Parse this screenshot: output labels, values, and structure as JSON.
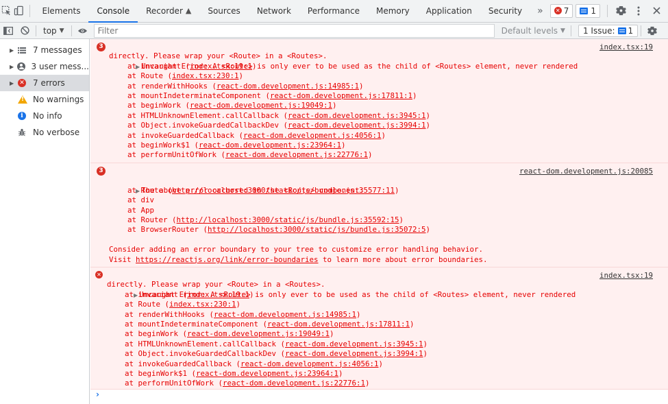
{
  "tabs": [
    {
      "label": "Elements"
    },
    {
      "label": "Console"
    },
    {
      "label": "Recorder"
    },
    {
      "label": "Sources"
    },
    {
      "label": "Network"
    },
    {
      "label": "Performance"
    },
    {
      "label": "Memory"
    },
    {
      "label": "Application"
    },
    {
      "label": "Security"
    }
  ],
  "topbar": {
    "more_label": "»",
    "error_count": "7",
    "issue_count": "1"
  },
  "toolbar": {
    "context": "top",
    "filter_placeholder": "Filter",
    "levels_label": "Default levels",
    "issues_label": "1 Issue:",
    "issues_count": "1"
  },
  "sidebar": {
    "items": [
      {
        "label": "7 messages"
      },
      {
        "label": "3 user mess..."
      },
      {
        "label": "7 errors"
      },
      {
        "label": "No warnings"
      },
      {
        "label": "No info"
      },
      {
        "label": "No verbose"
      }
    ]
  },
  "messages": [
    {
      "count": "3",
      "head": "Uncaught Error: A <Route> is only ever to be used as the child of <Routes> element, never rendered",
      "cont": "directly. Please wrap your <Route> in a <Routes>.",
      "source": "index.tsx:19",
      "frames": [
        {
          "fn": "at invariant (",
          "loc": "index.tsx:19:1",
          "end": ")"
        },
        {
          "fn": "at Route (",
          "loc": "index.tsx:230:1",
          "end": ")"
        },
        {
          "fn": "at renderWithHooks (",
          "loc": "react-dom.development.js:14985:1",
          "end": ")"
        },
        {
          "fn": "at mountIndeterminateComponent (",
          "loc": "react-dom.development.js:17811:1",
          "end": ")"
        },
        {
          "fn": "at beginWork (",
          "loc": "react-dom.development.js:19049:1",
          "end": ")"
        },
        {
          "fn": "at HTMLUnknownElement.callCallback (",
          "loc": "react-dom.development.js:3945:1",
          "end": ")"
        },
        {
          "fn": "at Object.invokeGuardedCallbackDev (",
          "loc": "react-dom.development.js:3994:1",
          "end": ")"
        },
        {
          "fn": "at invokeGuardedCallback (",
          "loc": "react-dom.development.js:4056:1",
          "end": ")"
        },
        {
          "fn": "at beginWork$1 (",
          "loc": "react-dom.development.js:23964:1",
          "end": ")"
        },
        {
          "fn": "at performUnitOfWork (",
          "loc": "react-dom.development.js:22776:1",
          "end": ")"
        }
      ]
    },
    {
      "count": "3",
      "head": "The above error occurred in the <Route> component:",
      "source": "react-dom.development.js:20085",
      "frames": [
        {
          "fn": "at Route (",
          "loc": "http://localhost:3000/static/js/bundle.js:35577:11",
          "end": ")"
        },
        {
          "fn": "at div",
          "loc": "",
          "end": ""
        },
        {
          "fn": "at App",
          "loc": "",
          "end": ""
        },
        {
          "fn": "at Router (",
          "loc": "http://localhost:3000/static/js/bundle.js:35592:15",
          "end": ")"
        },
        {
          "fn": "at BrowserRouter (",
          "loc": "http://localhost:3000/static/js/bundle.js:35072:5",
          "end": ")"
        }
      ],
      "footer1": "Consider adding an error boundary to your tree to customize error handling behavior.",
      "footer2_pre": "Visit ",
      "footer2_link": "https://reactjs.org/link/error-boundaries",
      "footer2_post": " to learn more about error boundaries."
    },
    {
      "head": "Uncaught Error: A <Route> is only ever to be used as the child of <Routes> element, never rendered",
      "cont": "directly. Please wrap your <Route> in a <Routes>.",
      "source": "index.tsx:19",
      "frames": [
        {
          "fn": "at invariant (",
          "loc": "index.tsx:19:1",
          "end": ")"
        },
        {
          "fn": "at Route (",
          "loc": "index.tsx:230:1",
          "end": ")"
        },
        {
          "fn": "at renderWithHooks (",
          "loc": "react-dom.development.js:14985:1",
          "end": ")"
        },
        {
          "fn": "at mountIndeterminateComponent (",
          "loc": "react-dom.development.js:17811:1",
          "end": ")"
        },
        {
          "fn": "at beginWork (",
          "loc": "react-dom.development.js:19049:1",
          "end": ")"
        },
        {
          "fn": "at HTMLUnknownElement.callCallback (",
          "loc": "react-dom.development.js:3945:1",
          "end": ")"
        },
        {
          "fn": "at Object.invokeGuardedCallbackDev (",
          "loc": "react-dom.development.js:3994:1",
          "end": ")"
        },
        {
          "fn": "at invokeGuardedCallback (",
          "loc": "react-dom.development.js:4056:1",
          "end": ")"
        },
        {
          "fn": "at beginWork$1 (",
          "loc": "react-dom.development.js:23964:1",
          "end": ")"
        },
        {
          "fn": "at performUnitOfWork (",
          "loc": "react-dom.development.js:22776:1",
          "end": ")"
        }
      ]
    }
  ],
  "prompt_symbol": "›",
  "colors": {
    "error": "#e60000",
    "error_bg": "#fff0f0",
    "accent": "#1a73e8"
  }
}
